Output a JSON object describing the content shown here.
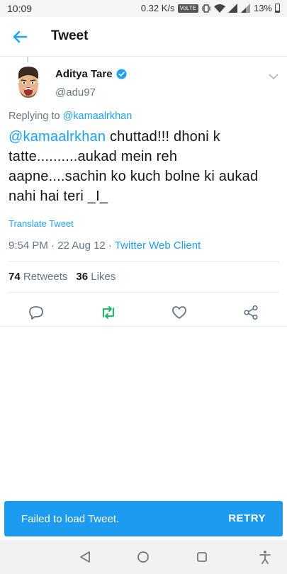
{
  "status_bar": {
    "time": "10:09",
    "network_speed": "0.32 K/s",
    "volte_label": "VoLTE",
    "battery": "13%"
  },
  "app_bar": {
    "title": "Tweet",
    "back_icon": "arrow-left-icon"
  },
  "tweet": {
    "author_name": "Aditya Tare",
    "author_handle": "@adu97",
    "verified": true,
    "replying_prefix": "Replying to ",
    "replying_to": "@kamaalrkhan",
    "mention": "@kamaalrkhan",
    "text": " chuttad!!! dhoni k tatte..........aukad mein reh aapne....sachin ko kuch bolne ki aukad nahi hai teri  _I_",
    "translate_label": "Translate Tweet",
    "timestamp": "9:54 PM · 22 Aug 12 · ",
    "client": "Twitter Web Client",
    "retweets_count": "74",
    "retweets_label": "Retweets",
    "likes_count": "36",
    "likes_label": "Likes"
  },
  "actions": [
    "reply-icon",
    "retweet-icon",
    "like-icon",
    "share-icon"
  ],
  "snackbar": {
    "message": "Failed to load Tweet.",
    "action": "RETRY"
  },
  "colors": {
    "accent": "#1da1f2",
    "retweet": "#17bf63",
    "snackbar": "#1d9bf0"
  }
}
